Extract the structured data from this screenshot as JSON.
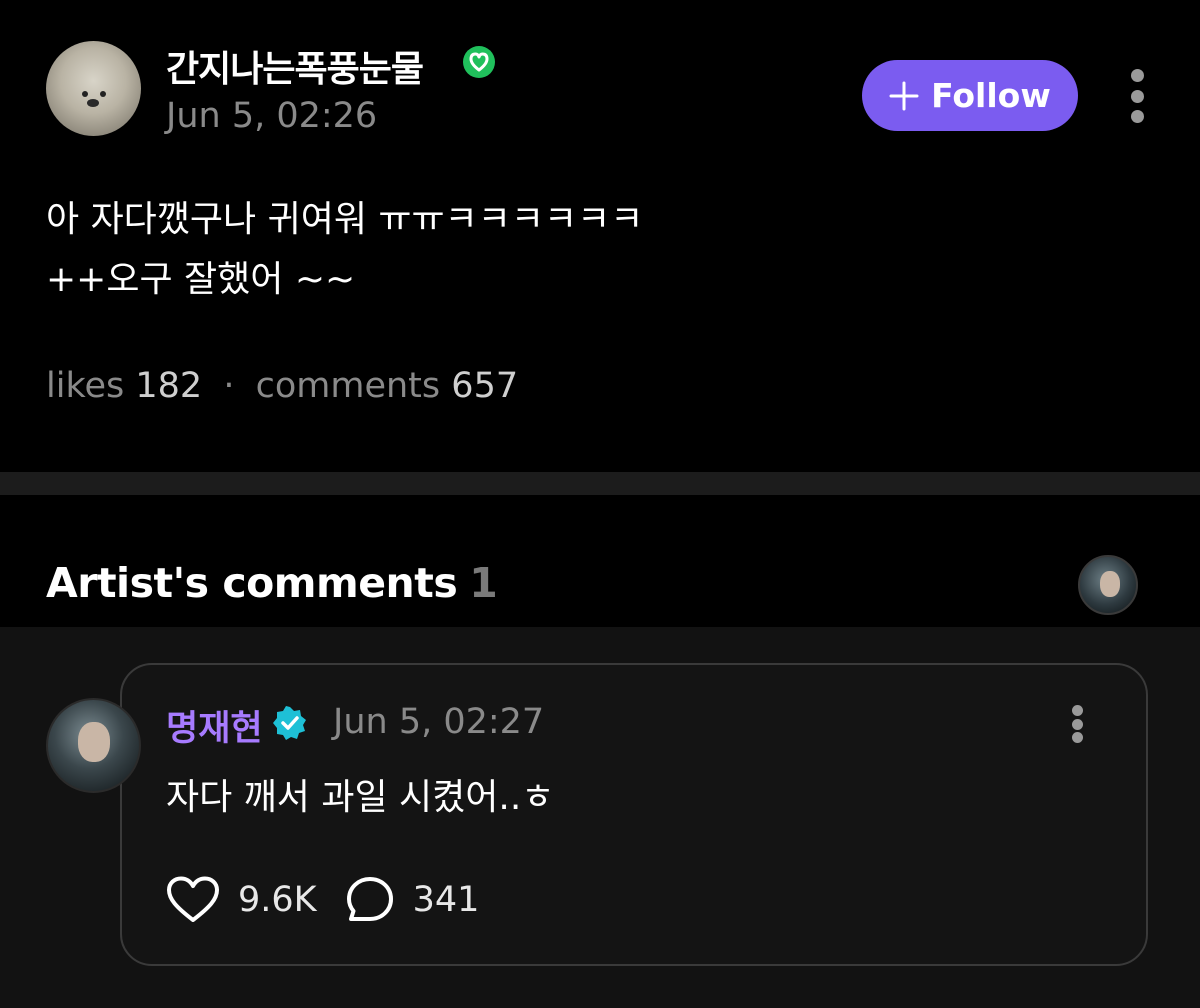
{
  "post": {
    "username": "간지나는폭풍눈물",
    "timestamp": "Jun 5, 02:26",
    "follow_label": "Follow",
    "body": "아 자다깼구나 귀여워 ㅠㅠㅋㅋㅋㅋㅋㅋ\n++오구 잘했어 ~~",
    "likes_label": "likes",
    "likes_count": "182",
    "separator": "·",
    "comments_label": "comments",
    "comments_count": "657"
  },
  "artist_comments": {
    "title": "Artist's comments",
    "count": "1"
  },
  "comment": {
    "username": "명재현",
    "timestamp": "Jun 5, 02:27",
    "body": "자다 깨서 과일 시켰어..ㅎ",
    "like_count": "9.6K",
    "reply_count": "341"
  },
  "colors": {
    "follow_button": "#7b5cf0",
    "artist_name": "#a77bff",
    "verified_green": "#20c05c",
    "verified_teal": "#1ec0d6"
  },
  "icons": [
    "verified-badge-green-icon",
    "plus-icon",
    "more-vertical-icon",
    "verified-badge-teal-icon",
    "heart-icon",
    "comment-bubble-icon"
  ]
}
